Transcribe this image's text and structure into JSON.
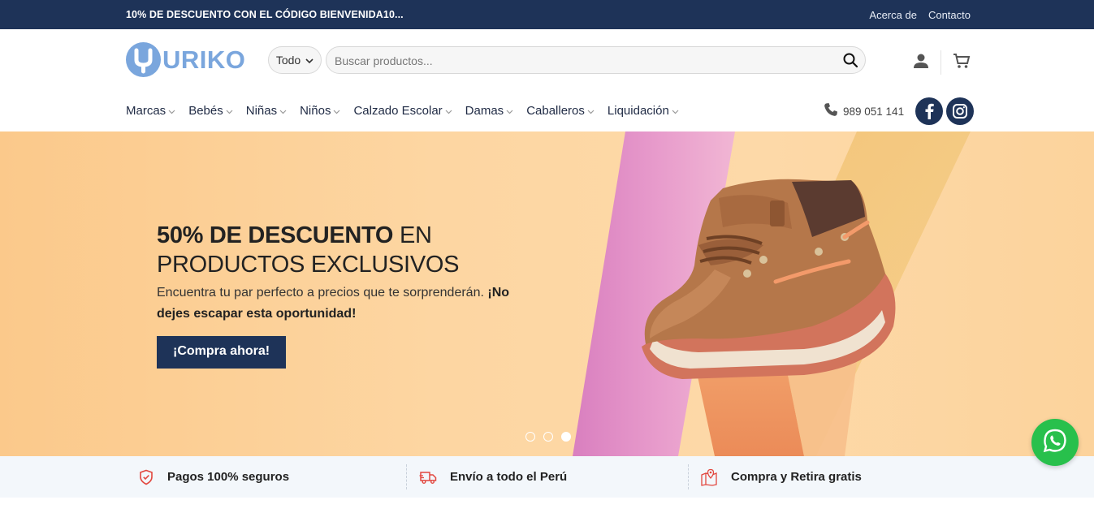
{
  "topbar": {
    "promo": "10% DE DESCUENTO CON EL CÓDIGO BIENVENIDA10...",
    "links": [
      "Acerca de",
      "Contacto"
    ]
  },
  "header": {
    "logo_text": "URIKO",
    "category_select": "Todo",
    "search_placeholder": "Buscar productos...",
    "icons": [
      "user-icon",
      "cart-icon"
    ]
  },
  "nav": {
    "items": [
      "Marcas",
      "Bebés",
      "Niñas",
      "Niños",
      "Calzado Escolar",
      "Damas",
      "Caballeros",
      "Liquidación"
    ],
    "phone": "989 051 141",
    "social": [
      "facebook-icon",
      "instagram-icon"
    ]
  },
  "hero": {
    "title_bold": "50% DE DESCUENTO",
    "title_rest": " EN",
    "title_line2": "PRODUCTOS EXCLUSIVOS",
    "subtitle": "Encuentra tu par perfecto a precios que te sorprenderán. ",
    "subtitle_bold": "¡No dejes escapar esta oportunidad!",
    "cta": "¡Compra ahora!",
    "slides": 3,
    "active_slide": 3
  },
  "features": [
    {
      "icon": "shield-icon",
      "label": "Pagos 100% seguros"
    },
    {
      "icon": "truck-icon",
      "label": "Envío a todo el Perú"
    },
    {
      "icon": "map-pin-icon",
      "label": "Compra y Retira gratis"
    }
  ],
  "colors": {
    "navy": "#1e3358",
    "logo_blue": "#7aa6dd",
    "whatsapp": "#28c04c",
    "accent_red": "#e2473f"
  }
}
